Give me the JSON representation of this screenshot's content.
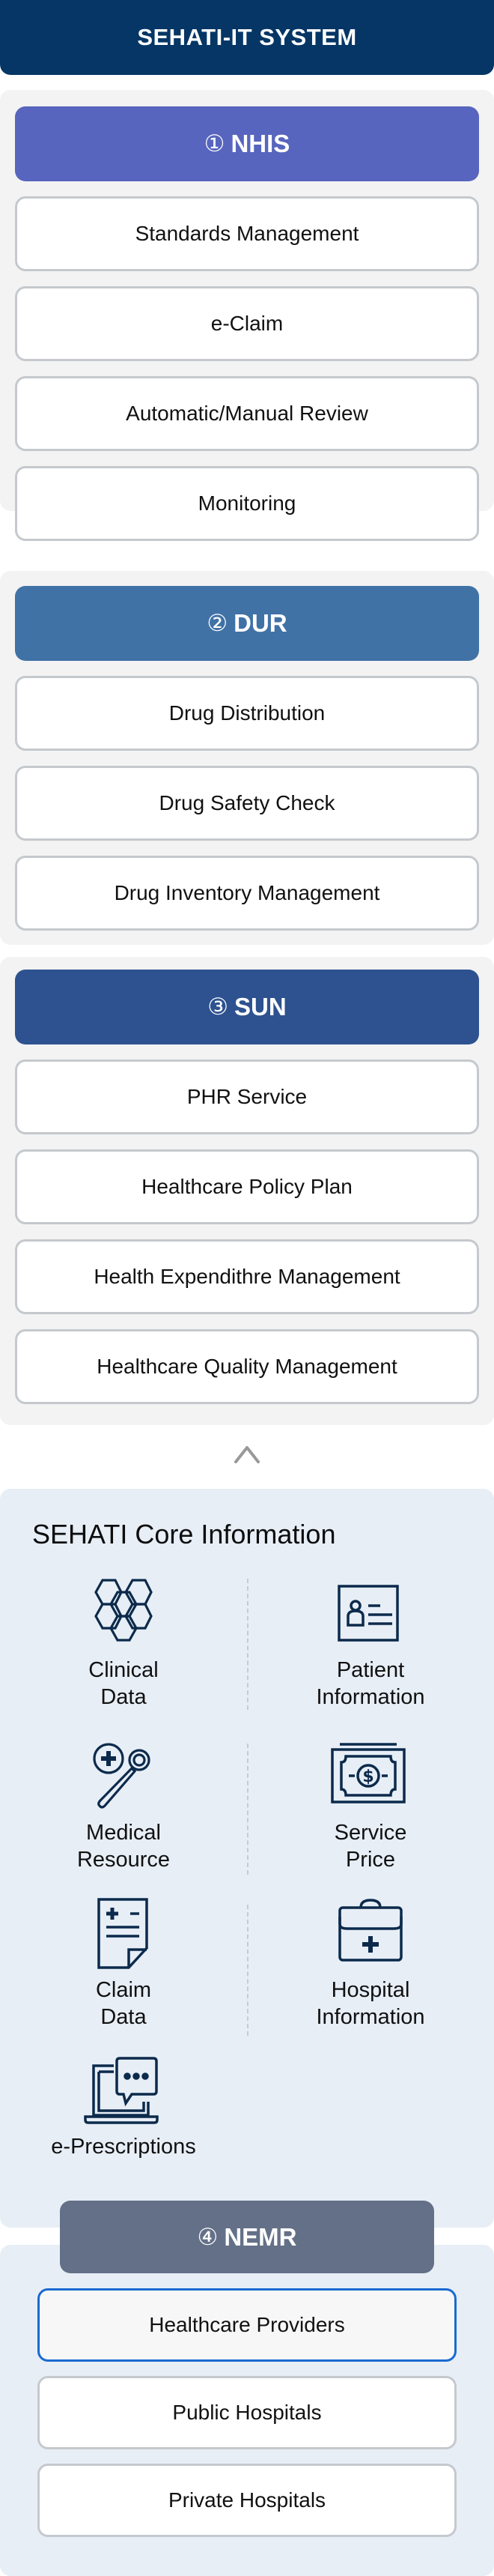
{
  "header": {
    "title": "SEHATI-IT SYSTEM"
  },
  "groups": [
    {
      "number": "①",
      "name": "NHIS",
      "color": "#5765be",
      "items": [
        "Standards Management",
        "e-Claim",
        "Automatic/Manual Review",
        "Monitoring"
      ]
    },
    {
      "number": "②",
      "name": "DUR",
      "color": "#4072a6",
      "items": [
        "Drug Distribution",
        "Drug Safety Check",
        "Drug Inventory Management"
      ]
    },
    {
      "number": "③",
      "name": "SUN",
      "color": "#2d528f",
      "items": [
        "PHR Service",
        "Healthcare Policy Plan",
        "Health Expendithre Management",
        "Healthcare Quality Management"
      ]
    }
  ],
  "collapse_icon": "chevron-up-icon",
  "core": {
    "title": "SEHATI Core Information",
    "icon_color": "#0c2a4b",
    "items": [
      {
        "icon": "hexagon-network-icon",
        "line1": "Clinical",
        "line2": "Data"
      },
      {
        "icon": "id-card-icon",
        "line1": "Patient",
        "line2": "Information"
      },
      {
        "icon": "medical-search-icon",
        "line1": "Medical",
        "line2": "Resource"
      },
      {
        "icon": "money-bill-icon",
        "line1": "Service",
        "line2": "Price"
      },
      {
        "icon": "claim-document-icon",
        "line1": "Claim",
        "line2": "Data"
      },
      {
        "icon": "medical-kit-icon",
        "line1": "Hospital",
        "line2": "Information"
      },
      {
        "icon": "laptop-chat-icon",
        "line1": "e-Prescriptions",
        "line2": ""
      }
    ]
  },
  "nemr": {
    "number": "④",
    "name": "NEMR",
    "color": "#647087",
    "active_index": 0,
    "items": [
      "Healthcare Providers",
      "Public Hospitals",
      "Private Hospitals"
    ]
  }
}
